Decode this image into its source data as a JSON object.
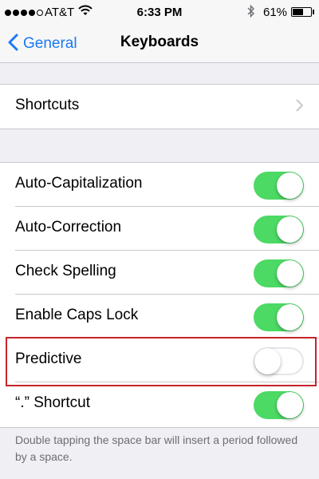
{
  "status_bar": {
    "carrier": "AT&T",
    "time": "6:33 PM",
    "battery_percent": "61%",
    "battery_level": 0.61,
    "signal_bars": 4,
    "signal_total": 5
  },
  "nav": {
    "back_label": "General",
    "title": "Keyboards"
  },
  "shortcuts_row": {
    "label": "Shortcuts"
  },
  "settings": [
    {
      "label": "Auto-Capitalization",
      "on": true
    },
    {
      "label": "Auto-Correction",
      "on": true
    },
    {
      "label": "Check Spelling",
      "on": true
    },
    {
      "label": "Enable Caps Lock",
      "on": true
    },
    {
      "label": "Predictive",
      "on": false
    },
    {
      "label": "“.” Shortcut",
      "on": true
    }
  ],
  "footer_note": "Double tapping the space bar will insert a period followed by a space.",
  "colors": {
    "accent": "#1a7af4",
    "toggle_on": "#4cd964",
    "highlight": "#c4242a"
  }
}
